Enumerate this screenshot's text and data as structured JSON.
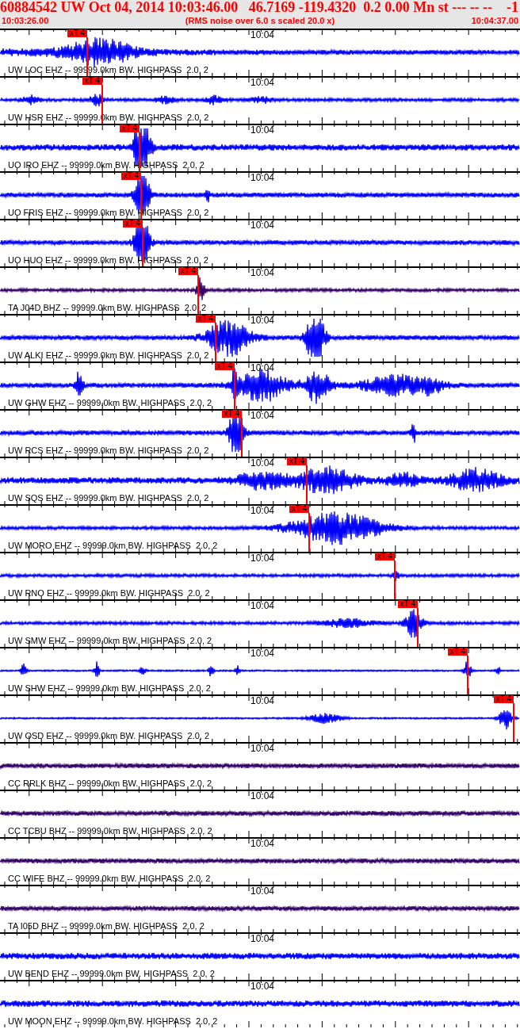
{
  "header": {
    "title": "60884542 UW Oct 04, 2014 10:03:46.00   46.7169 -119.4320  0.2 0.00 Mn st --- -- --",
    "flag": "-1",
    "start_time": "10:03:26.00",
    "scale_note": "(RMS noise over 6.0 s scaled 20.0 x)",
    "end_time": "10:04:37.00"
  },
  "traces": [
    {
      "label": "UW LOC EHZ -- 99999.0km BW. HIGHPASS  2.0, 2",
      "time_mark": "10:04",
      "pick": "xT 4",
      "color": "#0000ff"
    },
    {
      "label": "UW HSR EHZ -- 99999.0km BW. HIGHPASS  2.0, 2",
      "time_mark": "10:04",
      "pick": "xT 4",
      "color": "#0000ff"
    },
    {
      "label": "UO IRO EHZ -- 99999.0km BW. HIGHPASS  2.0, 2",
      "time_mark": "10:04",
      "pick": "xT 4",
      "color": "#0000ff"
    },
    {
      "label": "UO FRIS EHZ -- 99999.0km BW. HIGHPASS  2.0, 2",
      "time_mark": "10:04",
      "pick": "xT 4",
      "color": "#0000ff"
    },
    {
      "label": "UO HUO EHZ -- 99999.0km BW. HIGHPASS  2.0, 2",
      "time_mark": "10:04",
      "pick": "xT 4",
      "color": "#0000ff"
    },
    {
      "label": "TA J04D BHZ -- 99999.0km BW. HIGHPASS  2.0, 2",
      "time_mark": "10:04",
      "pick": "xT 4",
      "color": "#330066"
    },
    {
      "label": "UW ALKI EHZ -- 99999.0km BW. HIGHPASS  2.0, 2",
      "time_mark": "10:04",
      "pick": "xT 4",
      "color": "#0000ff"
    },
    {
      "label": "UW GHW EHZ -- 99999.0km BW. HIGHPASS  2.0, 2",
      "time_mark": "10:04",
      "pick": "xT 4",
      "color": "#0000ff"
    },
    {
      "label": "UW RCS EHZ -- 99999.0km BW. HIGHPASS  2.0, 2",
      "time_mark": "10:04",
      "pick": "xT 4",
      "color": "#0000ff"
    },
    {
      "label": "UW SQS EHZ -- 99999.0km BW. HIGHPASS  2.0, 2",
      "time_mark": "10:04",
      "pick": "xT 4",
      "color": "#0000ff"
    },
    {
      "label": "UW MORO EHZ -- 99999.0km BW. HIGHPASS  2.0, 2",
      "time_mark": "10:04",
      "pick": "xT 4",
      "color": "#0000ff"
    },
    {
      "label": "UW RNO EHZ -- 99999.0km BW. HIGHPASS  2.0, 2",
      "time_mark": "10:04",
      "pick": "xT 4",
      "color": "#0000ff"
    },
    {
      "label": "UW SMW EHZ -- 99999.0km BW. HIGHPASS  2.0, 2",
      "time_mark": "10:04",
      "pick": "xT 4",
      "color": "#0000ff"
    },
    {
      "label": "UW SHW EHZ -- 99999.0km BW. HIGHPASS  2.0, 2",
      "time_mark": "10:04",
      "pick": "xT 4",
      "color": "#0000ff"
    },
    {
      "label": "UW OSD EHZ -- 99999.0km BW. HIGHPASS  2.0, 2",
      "time_mark": "10:04",
      "pick": "xT 4",
      "color": "#0000ff"
    },
    {
      "label": "CC RRLK BHZ -- 99999.0km BW. HIGHPASS  2.0, 2",
      "time_mark": "10:04",
      "color": "#330066"
    },
    {
      "label": "CC TCBU BHZ -- 99999.0km BW. HIGHPASS  2.0, 2",
      "time_mark": "10:04",
      "color": "#330066"
    },
    {
      "label": "CC WIFE BHZ -- 99999.0km BW. HIGHPASS  2.0, 2",
      "time_mark": "10:04",
      "color": "#330066"
    },
    {
      "label": "TA I05D BHZ -- 99999.0km BW. HIGHPASS  2.0, 2",
      "time_mark": "10:04",
      "color": "#330066"
    },
    {
      "label": "UW BEND EHZ -- 99999.0km BW. HIGHPASS  2.0, 2",
      "time_mark": "10:04",
      "color": "#0000ff"
    },
    {
      "label": "UW MOON EHZ -- 99999.0km BW. HIGHPASS  2.0, 2",
      "time_mark": "10:04",
      "color": "#0000ff"
    }
  ]
}
